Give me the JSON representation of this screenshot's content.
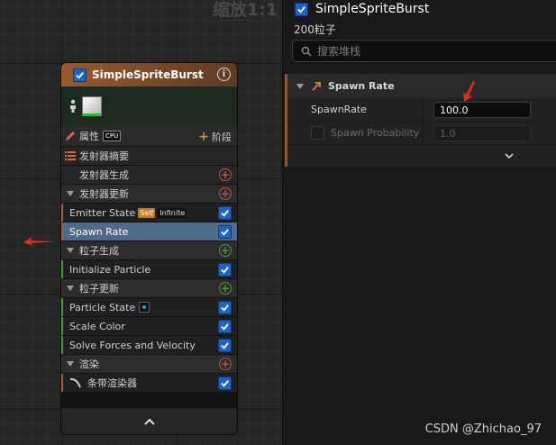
{
  "graph": {
    "zoom_label": "缩放1:1"
  },
  "node": {
    "title": "SimpleSpriteBurst",
    "info_glyph": "i",
    "properties_label": "属性",
    "cpu_tag": "CPU",
    "stage_button": "阶段",
    "summary_label": "发射器摘要",
    "emitter_spawn": "发射器生成",
    "emitter_update": "发射器更新",
    "emitter_state": "Emitter State",
    "tag_self": "Self",
    "tag_infinite": "Infinite",
    "spawn_rate": "Spawn Rate",
    "particle_spawn": "粒子生成",
    "initialize_particle": "Initialize Particle",
    "particle_update": "粒子更新",
    "particle_state": "Particle State",
    "scale_color": "Scale Color",
    "solve_forces": "Solve Forces and Velocity",
    "render": "渲染",
    "ribbon_renderer": "条带渲染器",
    "colors": {
      "header_start": "#9a5a2e",
      "selected": "#4e6b8a",
      "checkbox": "#1d63c8",
      "edge_red": "#b55646",
      "edge_green": "#4a9a3c"
    }
  },
  "panel": {
    "title": "SimpleSpriteBurst",
    "particle_count": "200粒子",
    "search_placeholder": "搜索堆栈",
    "section_title": "Spawn Rate",
    "spawn_rate_label": "SpawnRate",
    "spawn_rate_value": "100.0",
    "spawn_probability_label": "Spawn Probability",
    "spawn_probability_value": "1.0"
  },
  "watermark": "CSDN @Zhichao_97"
}
